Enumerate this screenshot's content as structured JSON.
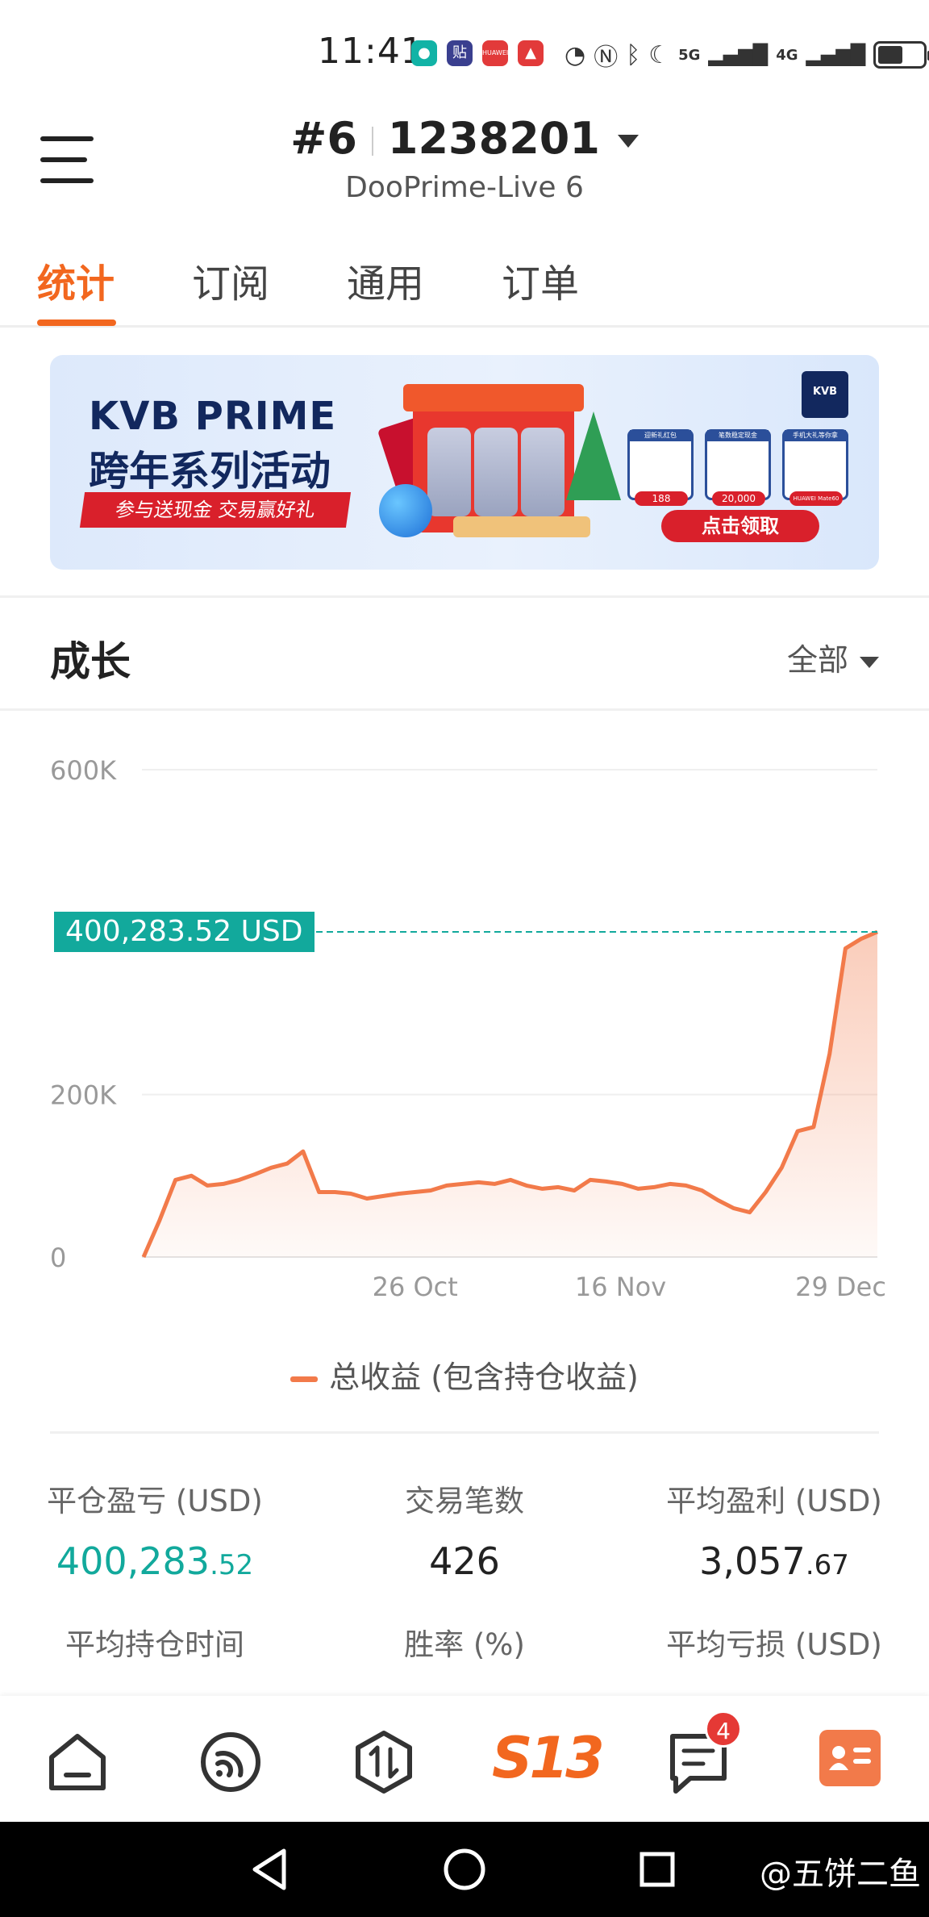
{
  "status_bar": {
    "time": "11:41",
    "app_badges": [
      "贴",
      "HUAWEI"
    ],
    "signal_labels": [
      "5G",
      "4G"
    ]
  },
  "header": {
    "account_number": "#6",
    "account_id": "1238201",
    "server": "DooPrime-Live 6"
  },
  "tabs": [
    {
      "label": "统计",
      "active": true
    },
    {
      "label": "订阅",
      "active": false
    },
    {
      "label": "通用",
      "active": false
    },
    {
      "label": "订单",
      "active": false
    }
  ],
  "banner": {
    "headline": "KVB PRIME",
    "subheadline": "跨年系列活动",
    "ribbon": "参与送现金 交易赢好礼",
    "logo": "KVB",
    "prizes": [
      {
        "caption": "迎新礼红包",
        "value": "188"
      },
      {
        "caption": "笔数稳定现金",
        "value": "20,000"
      },
      {
        "caption": "手机大礼等你拿",
        "value": "HUAWEI Mate60"
      }
    ],
    "cta": "点击领取"
  },
  "growth": {
    "title": "成长",
    "range": "全部"
  },
  "chart_data": {
    "type": "area",
    "y_ticks": [
      "600K",
      "200K",
      "0"
    ],
    "x_ticks": [
      "26 Oct",
      "16 Nov",
      "29 Dec"
    ],
    "ylim": [
      0,
      600000
    ],
    "current_value_label": "400,283.52 USD",
    "current_value": 400283.52,
    "series": [
      {
        "name": "总收益 (包含持仓收益)",
        "color": "#f27a4a",
        "values": [
          0,
          45000,
          95000,
          100000,
          88000,
          90000,
          95000,
          102000,
          110000,
          115000,
          130000,
          80000,
          80000,
          78000,
          72000,
          75000,
          78000,
          80000,
          82000,
          88000,
          90000,
          92000,
          90000,
          95000,
          88000,
          84000,
          86000,
          82000,
          95000,
          93000,
          90000,
          84000,
          86000,
          90000,
          88000,
          82000,
          70000,
          60000,
          55000,
          80000,
          110000,
          155000,
          160000,
          250000,
          380000,
          392000,
          400283.52
        ]
      }
    ]
  },
  "legend_label": "总收益 (包含持仓收益)",
  "stats": {
    "row1": [
      {
        "label": "平仓盈亏 (USD)",
        "int": "400,283",
        "dec": ".52",
        "highlight": true
      },
      {
        "label": "交易笔数",
        "int": "426",
        "dec": "",
        "highlight": false
      },
      {
        "label": "平均盈利 (USD)",
        "int": "3,057",
        "dec": ".67",
        "highlight": false
      }
    ],
    "row2": [
      {
        "label": "平均持仓时间"
      },
      {
        "label": "胜率 (%)"
      },
      {
        "label": "平均亏损 (USD)"
      }
    ]
  },
  "bottom_nav": {
    "brand": "S13",
    "message_badge": "4"
  },
  "watermark": "@五饼二鱼",
  "colors": {
    "accent": "#f2671f",
    "positive": "#12a99c",
    "line": "#f27a4a"
  }
}
